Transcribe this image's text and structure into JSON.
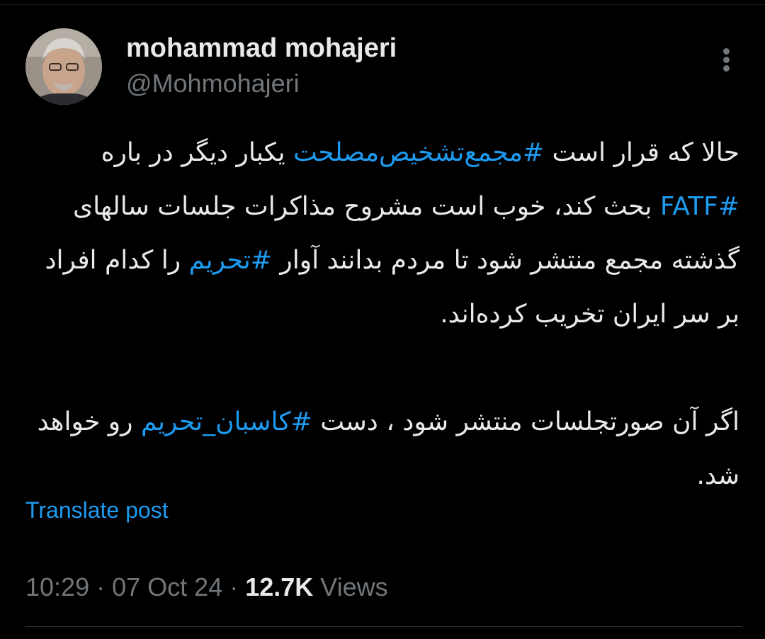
{
  "author": {
    "display_name": "mohammad mohajeri",
    "handle": "@Mohmohajeri"
  },
  "post": {
    "paragraph1": {
      "seg1": "حالا که قرار است ",
      "tag1": "#مجمع‌تشخیص‌مصلحت",
      "seg2": " یکبار دیگر در باره ",
      "tag2": "#FATF",
      "seg3": " بحث کند، خوب است مشروح مذاکرات جلسات سالهای گذشته مجمع منتشر شود تا مردم بدانند آوار ",
      "tag3": "#تحریم",
      "seg4": " را کدام افراد بر سر ایران تخریب کرده‌اند."
    },
    "paragraph2": {
      "seg1": "اگر آن صورتجلسات منتشر شود ، دست ",
      "tag1": "#کاسبان_تحریم",
      "seg2": " رو خواهد شد."
    }
  },
  "actions": {
    "translate_label": "Translate post",
    "more_icon": "more-vertical-icon"
  },
  "meta": {
    "time": "10:29",
    "separator1": " · ",
    "date": "07 Oct 24",
    "separator2": " · ",
    "views_count": "12.7K",
    "views_label": " Views"
  },
  "colors": {
    "background": "#000000",
    "text_primary": "#e7e9ea",
    "text_secondary": "#71767b",
    "accent": "#1d9bf0"
  }
}
